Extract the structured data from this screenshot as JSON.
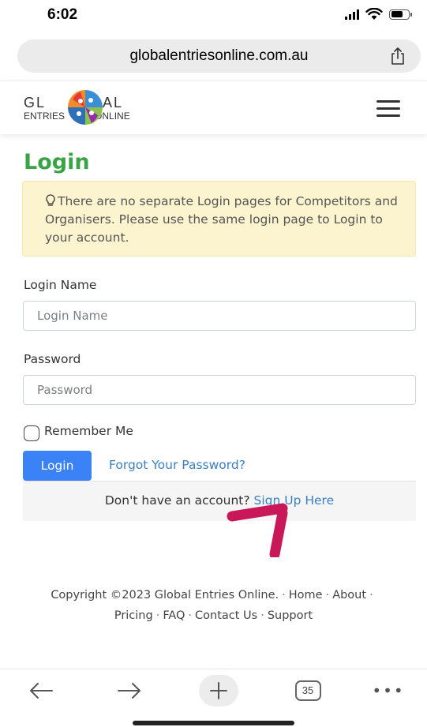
{
  "status_bar": {
    "time": "6:02"
  },
  "browser": {
    "url": "globalentriesonline.com.au",
    "tab_count": "35",
    "more_label": "•••"
  },
  "site": {
    "logo_top_left": "GL",
    "logo_top_right": "BAL",
    "logo_bottom_left": "ENTRIES",
    "logo_bottom_right": "ONLINE"
  },
  "login": {
    "title": "Login",
    "notice": "There are no separate Login pages for Competitors and Organisers. Please use the same login page to Login to your account.",
    "login_name_label": "Login Name",
    "login_name_placeholder": "Login Name",
    "password_label": "Password",
    "password_placeholder": "Password",
    "remember_label": "Remember Me",
    "login_button": "Login",
    "forgot_link": "Forgot Your Password?",
    "signup_prompt": "Don't have an account?",
    "signup_link": "Sign Up Here"
  },
  "footer": {
    "copyright": "Copyright ©2023 Global Entries Online.",
    "links": [
      "Home",
      "About",
      "Pricing",
      "FAQ",
      "Contact Us",
      "Support"
    ]
  },
  "colors": {
    "title_green": "#3aa346",
    "alert_bg": "#fcf3cf",
    "primary_blue": "#3b82f6",
    "link_blue": "#3a7fc1",
    "annotation_arrow": "#c8185a"
  },
  "icons": {
    "share": "share-icon",
    "menu": "hamburger-menu-icon",
    "notice": "lightbulb-icon",
    "back": "arrow-left-icon",
    "forward": "arrow-right-icon",
    "new_tab": "plus-icon",
    "tabs": "tabs-icon",
    "more": "ellipsis-icon",
    "annotation": "annotation-arrow-icon"
  }
}
